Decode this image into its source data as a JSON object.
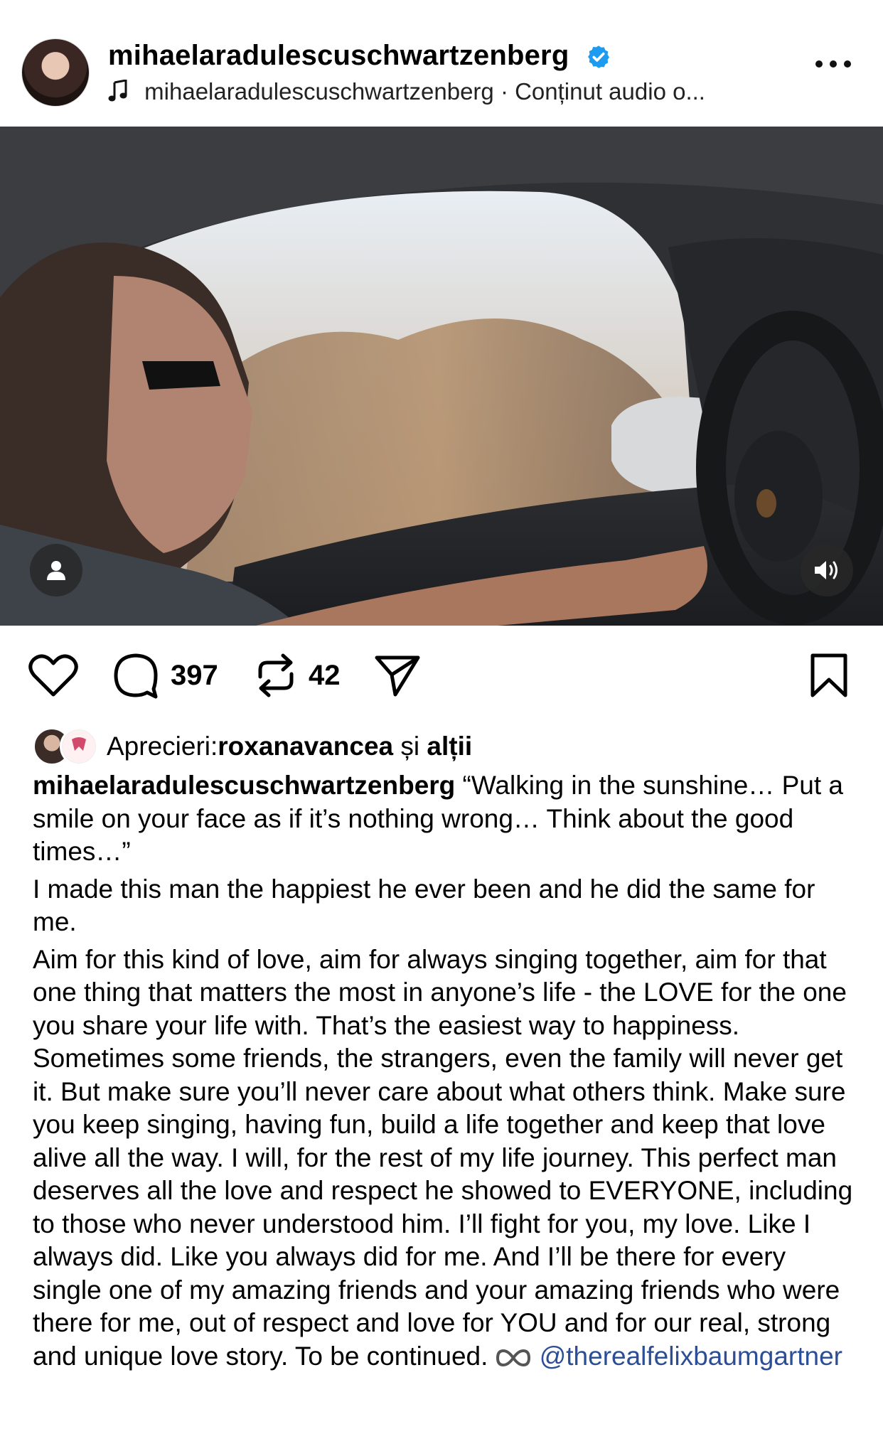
{
  "header": {
    "username": "mihaelaradulescuschwartzenberg",
    "audio_text": "mihaelaradulescuschwartzenberg · Conținut audio o...",
    "verified_color": "#1d9bf0"
  },
  "post": {
    "comment_count": "397",
    "repost_count": "42",
    "liked_by_label": "Aprecieri: ",
    "liked_by_user": "roxanavancea",
    "liked_by_and": " și ",
    "liked_by_others": "alții",
    "caption_user": "mihaelaradulescuschwartzenberg",
    "caption_quote": " “Walking in the sunshine… Put a smile on your face as if it’s nothing wrong… Think about the good times…”",
    "caption_p2": "I made this man the happiest he ever been and he did the same for me.",
    "caption_p3": "Aim for this kind of love, aim for always singing together, aim for that one thing that matters the most in anyone’s life - the LOVE for the one you share your life with. That’s the easiest way to happiness. Sometimes some friends, the strangers, even the family will never get it. But make sure you’ll never care about what others think. Make sure you keep singing, having fun, build a life together and keep that love alive all the way. I will, for the rest of my life journey. This perfect man deserves all the love and respect he showed to EVERYONE, including to those who never understood him. I’ll fight for you, my love. Like I always did. Like you always did for me. And I’ll be there for every single one of my amazing friends and your amazing friends who were there for me, out of respect and love for YOU and for our real, strong and unique love story. To be continued. ",
    "caption_mention": "@therealfelixbaumgartner",
    "mention_color": "#2b4e96"
  },
  "icons": {
    "music": "music-note-icon",
    "more": "more-options-icon",
    "like": "heart-icon",
    "comment": "comment-icon",
    "repost": "repost-icon",
    "share": "share-icon",
    "save": "bookmark-icon",
    "tags": "person-tag-icon",
    "sound": "speaker-icon",
    "infinity": "infinity-icon"
  }
}
